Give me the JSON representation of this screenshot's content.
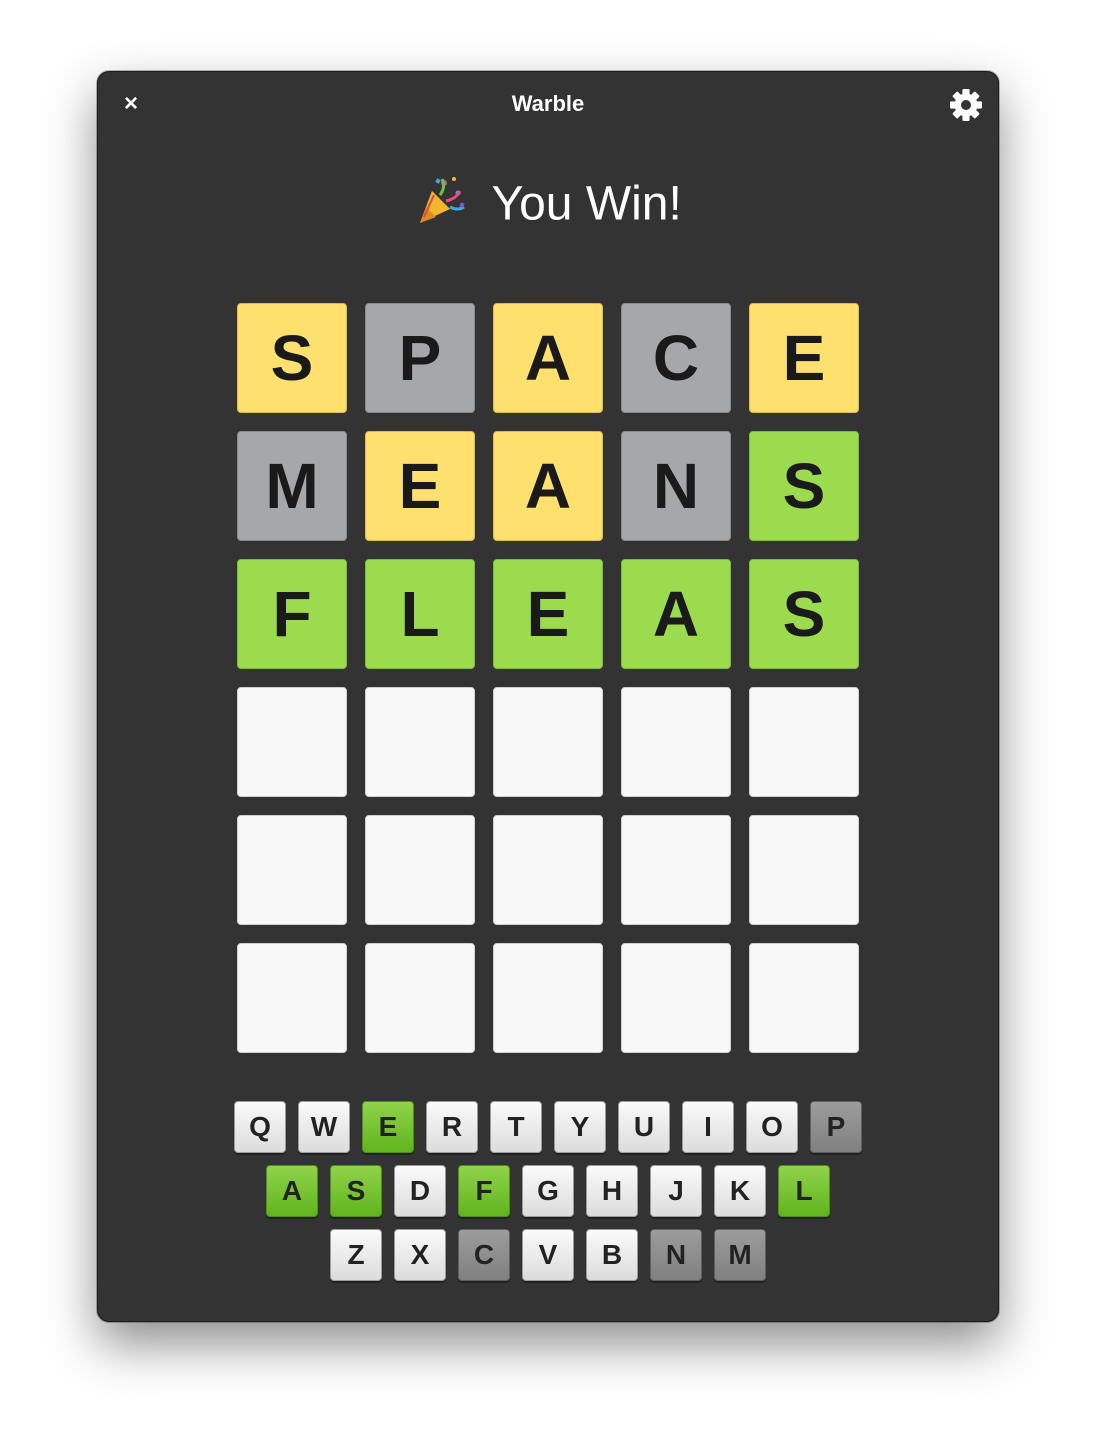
{
  "window": {
    "title": "Warble",
    "close_label": "×"
  },
  "status": {
    "emoji": "party-popper-icon",
    "text": "You Win!"
  },
  "colors": {
    "present": "#fde06e",
    "absent": "#a6a7a9",
    "correct": "#9bdb4d",
    "empty": "#f8f8f8",
    "window_bg": "#333333"
  },
  "board": [
    [
      {
        "letter": "S",
        "state": "present"
      },
      {
        "letter": "P",
        "state": "absent"
      },
      {
        "letter": "A",
        "state": "present"
      },
      {
        "letter": "C",
        "state": "absent"
      },
      {
        "letter": "E",
        "state": "present"
      }
    ],
    [
      {
        "letter": "M",
        "state": "absent"
      },
      {
        "letter": "E",
        "state": "present"
      },
      {
        "letter": "A",
        "state": "present"
      },
      {
        "letter": "N",
        "state": "absent"
      },
      {
        "letter": "S",
        "state": "correct"
      }
    ],
    [
      {
        "letter": "F",
        "state": "correct"
      },
      {
        "letter": "L",
        "state": "correct"
      },
      {
        "letter": "E",
        "state": "correct"
      },
      {
        "letter": "A",
        "state": "correct"
      },
      {
        "letter": "S",
        "state": "correct"
      }
    ],
    [
      {
        "letter": "",
        "state": "empty"
      },
      {
        "letter": "",
        "state": "empty"
      },
      {
        "letter": "",
        "state": "empty"
      },
      {
        "letter": "",
        "state": "empty"
      },
      {
        "letter": "",
        "state": "empty"
      }
    ],
    [
      {
        "letter": "",
        "state": "empty"
      },
      {
        "letter": "",
        "state": "empty"
      },
      {
        "letter": "",
        "state": "empty"
      },
      {
        "letter": "",
        "state": "empty"
      },
      {
        "letter": "",
        "state": "empty"
      }
    ],
    [
      {
        "letter": "",
        "state": "empty"
      },
      {
        "letter": "",
        "state": "empty"
      },
      {
        "letter": "",
        "state": "empty"
      },
      {
        "letter": "",
        "state": "empty"
      },
      {
        "letter": "",
        "state": "empty"
      }
    ]
  ],
  "keyboard": [
    [
      {
        "key": "Q",
        "state": "unused"
      },
      {
        "key": "W",
        "state": "unused"
      },
      {
        "key": "E",
        "state": "correct"
      },
      {
        "key": "R",
        "state": "unused"
      },
      {
        "key": "T",
        "state": "unused"
      },
      {
        "key": "Y",
        "state": "unused"
      },
      {
        "key": "U",
        "state": "unused"
      },
      {
        "key": "I",
        "state": "unused"
      },
      {
        "key": "O",
        "state": "unused"
      },
      {
        "key": "P",
        "state": "absent"
      }
    ],
    [
      {
        "key": "A",
        "state": "correct"
      },
      {
        "key": "S",
        "state": "correct"
      },
      {
        "key": "D",
        "state": "unused"
      },
      {
        "key": "F",
        "state": "correct"
      },
      {
        "key": "G",
        "state": "unused"
      },
      {
        "key": "H",
        "state": "unused"
      },
      {
        "key": "J",
        "state": "unused"
      },
      {
        "key": "K",
        "state": "unused"
      },
      {
        "key": "L",
        "state": "correct"
      }
    ],
    [
      {
        "key": "Z",
        "state": "unused"
      },
      {
        "key": "X",
        "state": "unused"
      },
      {
        "key": "C",
        "state": "absent"
      },
      {
        "key": "V",
        "state": "unused"
      },
      {
        "key": "B",
        "state": "unused"
      },
      {
        "key": "N",
        "state": "absent"
      },
      {
        "key": "M",
        "state": "absent"
      }
    ]
  ]
}
